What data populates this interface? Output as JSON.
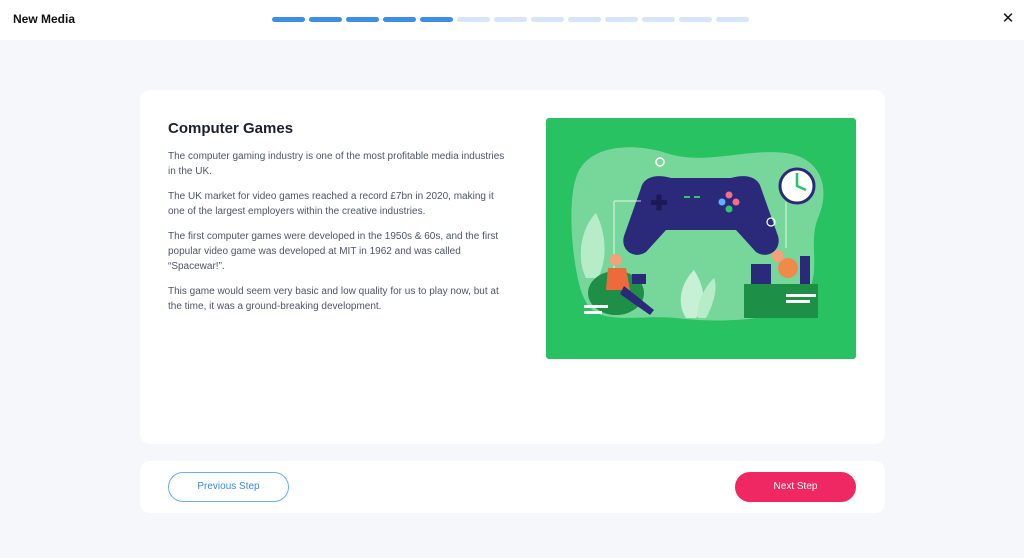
{
  "header": {
    "title": "New Media",
    "progress": {
      "total_steps": 13,
      "completed_steps": 5
    },
    "close_label": "✕"
  },
  "content": {
    "heading": "Computer Games",
    "paragraphs": [
      "The computer gaming industry is one of the most profitable media industries in the UK.",
      "The UK market for video games reached a record £7bn in 2020, making it one of the largest employers within the creative industries.",
      "The first computer games were developed in the 1950s & 60s, and the first popular video game was developed at MIT in 1962 and was called “Spacewar!”.",
      "This game would seem very basic and low quality for us to play now, but at the time, it was a ground-breaking development."
    ],
    "illustration": {
      "subject": "game-controller-illustration",
      "background_color": "#28c263"
    }
  },
  "footer": {
    "previous_label": "Previous Step",
    "next_label": "Next Step"
  },
  "colors": {
    "accent": "#3d8fe6",
    "primary_button": "#ef2763",
    "progress_inactive": "#d6e6f8"
  }
}
